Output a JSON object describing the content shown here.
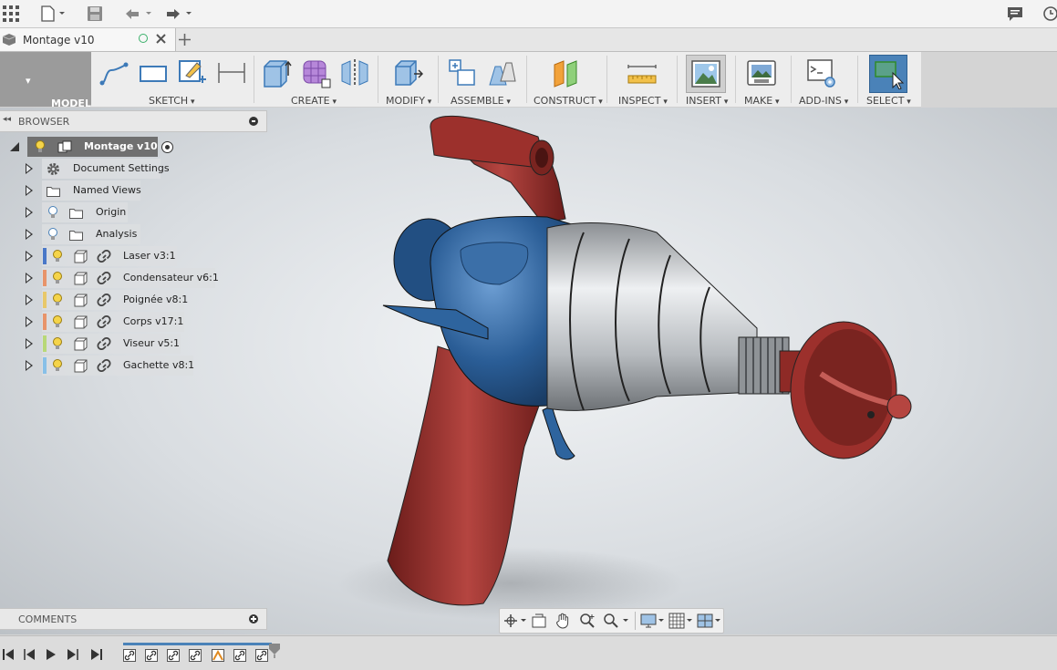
{
  "app": {
    "doc_tab_title": "Montage v10"
  },
  "toolbar": {
    "workspace": "MODEL",
    "groups": {
      "sketch": "SKETCH",
      "create": "CREATE",
      "modify": "MODIFY",
      "assemble": "ASSEMBLE",
      "construct": "CONSTRUCT",
      "inspect": "INSPECT",
      "insert": "INSERT",
      "make": "MAKE",
      "addins": "ADD-INS",
      "select": "SELECT"
    }
  },
  "browser": {
    "header": "BROWSER",
    "root": "Montage v10",
    "items": [
      {
        "label": "Document Settings",
        "icon": "gear-icon"
      },
      {
        "label": "Named Views",
        "icon": "folder-icon"
      },
      {
        "label": "Origin",
        "icon": "folder-icon"
      },
      {
        "label": "Analysis",
        "icon": "folder-icon"
      },
      {
        "label": "Laser v3:1",
        "color": "#4a78c8"
      },
      {
        "label": "Condensateur v6:1",
        "color": "#e8946a"
      },
      {
        "label": "Poignée v8:1",
        "color": "#e8c86a"
      },
      {
        "label": "Corps v17:1",
        "color": "#e8946a"
      },
      {
        "label": "Viseur v5:1",
        "color": "#b8d878"
      },
      {
        "label": "Gachette v8:1",
        "color": "#88c0e8"
      }
    ]
  },
  "comments": {
    "header": "COMMENTS"
  },
  "colors": {
    "accent_blue": "#3d7ab8",
    "body_red": "#8e2a26",
    "body_blue": "#2a5d96"
  }
}
